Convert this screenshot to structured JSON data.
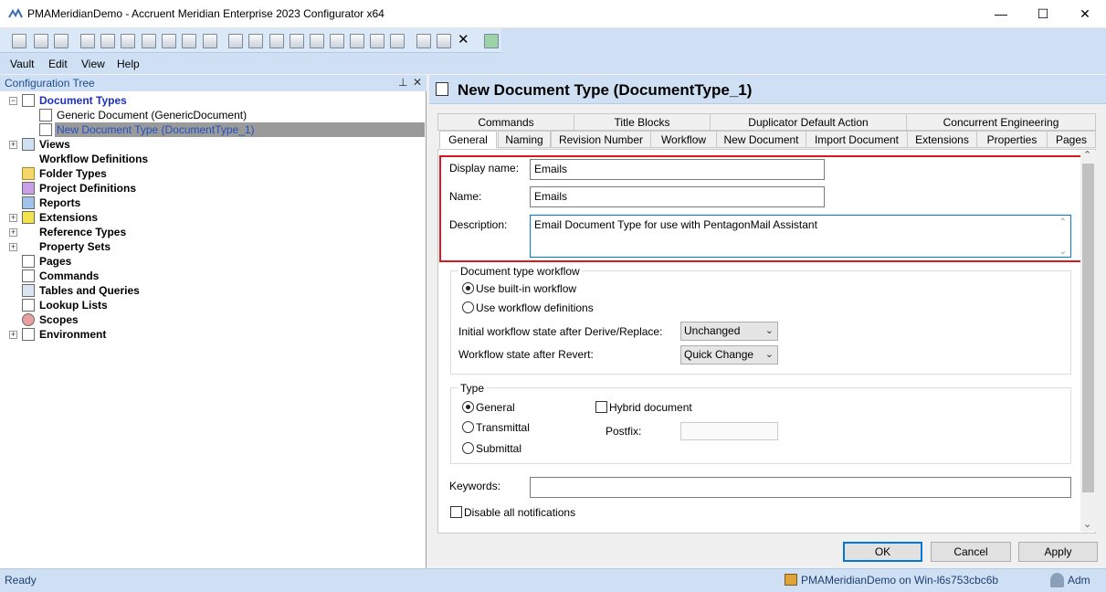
{
  "window": {
    "title": "PMAMeridianDemo - Accruent Meridian Enterprise 2023 Configurator x64",
    "minimize": "—",
    "maximize": "☐",
    "close": "✕"
  },
  "menu": [
    "Vault",
    "Edit",
    "View",
    "Help"
  ],
  "tree": {
    "title": "Configuration Tree",
    "pin": "⊥",
    "close": "✕",
    "root": "Document Types",
    "children": [
      "Generic Document (GenericDocument)",
      "New Document Type (DocumentType_1)"
    ],
    "items": [
      "Views",
      "Workflow Definitions",
      "Folder Types",
      "Project Definitions",
      "Reports",
      "Extensions",
      "Reference Types",
      "Property Sets",
      "Pages",
      "Commands",
      "Tables and Queries",
      "Lookup Lists",
      "Scopes",
      "Environment"
    ]
  },
  "editor": {
    "title": "New Document Type (DocumentType_1)",
    "tabs_row1": [
      "Commands",
      "Title Blocks",
      "Duplicator Default Action",
      "Concurrent Engineering"
    ],
    "tabs_row2": [
      "General",
      "Naming",
      "Revision Number",
      "Workflow",
      "New Document",
      "Import Document",
      "Extensions",
      "Properties",
      "Pages"
    ],
    "display_name_label": "Display name:",
    "display_name_value": "Emails",
    "name_label": "Name:",
    "name_value": "Emails",
    "description_label": "Description:",
    "description_value": "Email Document Type for use with PentagonMail Assistant",
    "workflow_group": "Document type workflow",
    "builtin_workflow": "Use built-in workflow",
    "workflow_definitions": "Use workflow definitions",
    "initial_state_label": "Initial workflow state after Derive/Replace:",
    "initial_state_value": "Unchanged",
    "revert_label": "Workflow state after Revert:",
    "revert_value": "Quick Change",
    "type_group": "Type",
    "type_general": "General",
    "type_transmittal": "Transmittal",
    "type_submittal": "Submittal",
    "hybrid_label": "Hybrid document",
    "postfix_label": "Postfix:",
    "keywords_label": "Keywords:",
    "disable_notifications": "Disable all notifications",
    "ok": "OK",
    "cancel": "Cancel",
    "apply": "Apply"
  },
  "status": {
    "ready": "Ready",
    "connection": "PMAMeridianDemo on Win-l6s753cbc6b",
    "user": "Adm"
  }
}
